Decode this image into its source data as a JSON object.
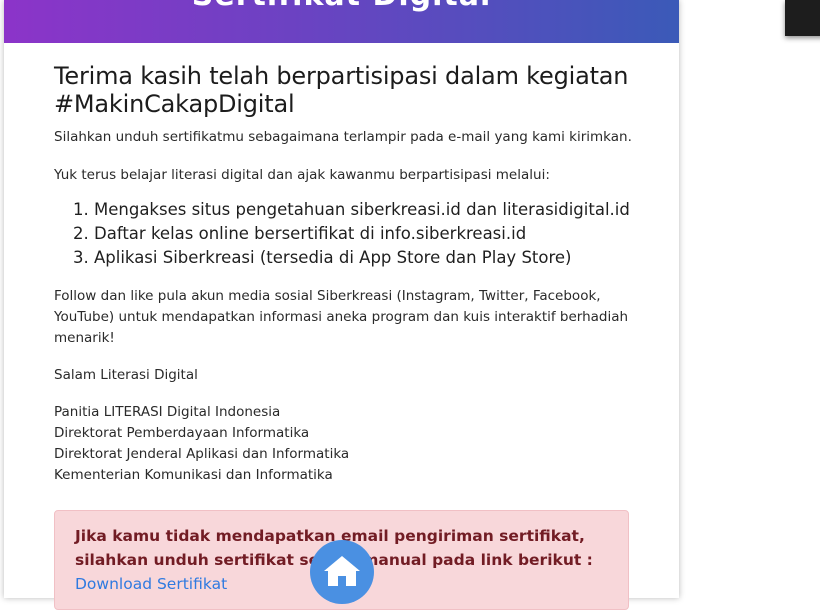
{
  "header": {
    "title": "Sertifikat Digital"
  },
  "content": {
    "heading": "Terima kasih telah berpartisipasi dalam kegiatan #MakinCakapDigital",
    "intro": "Silahkan unduh sertifikatmu sebagaimana terlampir pada e-mail yang kami kirimkan.",
    "invite": "Yuk terus belajar literasi digital dan ajak kawanmu berpartisipasi melalui:",
    "list": [
      "Mengakses situs pengetahuan siberkreasi.id dan literasidigital.id",
      "Daftar kelas online bersertifikat di info.siberkreasi.id",
      "Aplikasi Siberkreasi (tersedia di App Store dan Play Store)"
    ],
    "follow": "Follow dan like pula akun media sosial Siberkreasi (Instagram, Twitter, Facebook, YouTube) untuk mendapatkan informasi aneka program dan kuis interaktif berhadiah menarik!",
    "salam": "Salam Literasi Digital",
    "signature": [
      "Panitia LITERASI Digital Indonesia",
      "Direktorat Pemberdayaan Informatika",
      "Direktorat Jenderal Aplikasi dan Informatika",
      "Kementerian Komunikasi dan Informatika"
    ]
  },
  "alert": {
    "text": "Jika kamu tidak mendapatkan email pengiriman sertifikat, silahkan unduh sertifikat secara manual pada link berikut :",
    "link_label": "Download Sertifikat"
  },
  "fab": {
    "icon": "home-icon",
    "color": "#4a90e2"
  }
}
